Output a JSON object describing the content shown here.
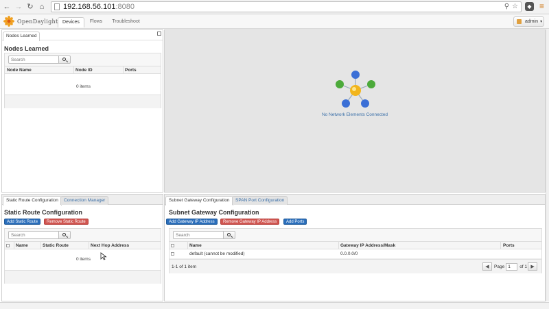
{
  "browser": {
    "url_host": "192.168.56.101",
    "url_port": ":8080"
  },
  "app": {
    "logo_text": "OpenDaylight",
    "tabs": [
      {
        "label": "Devices",
        "active": true
      },
      {
        "label": "Flows",
        "active": false
      },
      {
        "label": "Troubleshoot",
        "active": false
      }
    ],
    "user_menu": "admin"
  },
  "nodes_panel": {
    "tab_label": "Nodes Learned",
    "title": "Nodes Learned",
    "search_placeholder": "Search",
    "columns": [
      "Node Name",
      "Node ID",
      "Ports"
    ],
    "empty_text": "0 items"
  },
  "topology": {
    "message": "No Network Elements Connected"
  },
  "static_route_panel": {
    "tabs": [
      "Static Route Configuration",
      "Connection Manager"
    ],
    "title": "Static Route Configuration",
    "add_button": "Add Static Route",
    "remove_button": "Remove Static Route",
    "search_placeholder": "Search",
    "columns": [
      "Name",
      "Static Route",
      "Next Hop Address"
    ],
    "empty_text": "0 items"
  },
  "subnet_panel": {
    "tabs": [
      "Subnet Gateway Configuration",
      "SPAN Port Configuration"
    ],
    "title": "Subnet Gateway Configuration",
    "add_button": "Add Gateway IP Address",
    "remove_button": "Remove Gateway IP Address",
    "ports_button": "Add Ports",
    "search_placeholder": "Search",
    "columns": [
      "Name",
      "Gateway IP Address/Mask",
      "Ports"
    ],
    "rows": [
      {
        "name": "default (cannot be modified)",
        "gateway": "0.0.0.0/0",
        "ports": ""
      }
    ],
    "footer_count": "1-1 of 1 item",
    "pager": {
      "page_label": "Page",
      "page_value": "1",
      "of_label": "of 1"
    }
  },
  "colors": {
    "link_blue": "#3a6fa8",
    "button_blue": "#2a6ebb",
    "button_red": "#d05550",
    "topology_bg": "#e5e5e5"
  }
}
